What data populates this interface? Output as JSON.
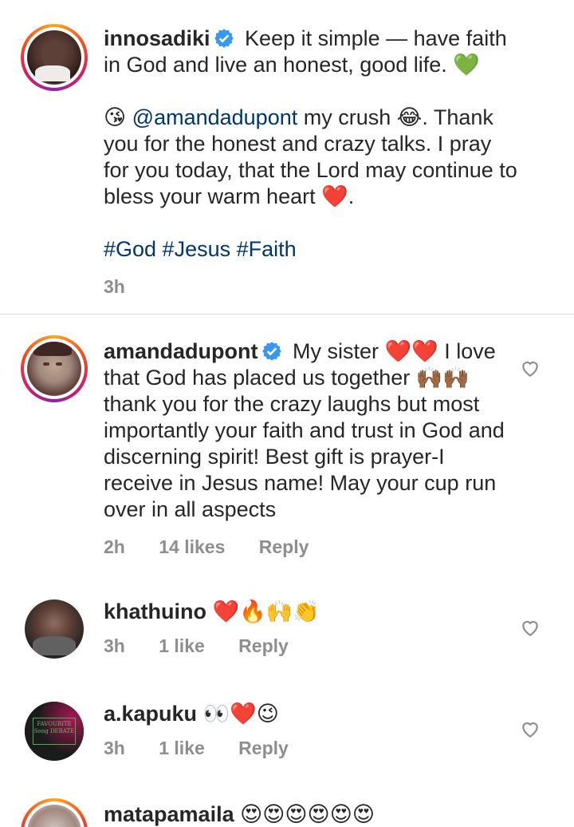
{
  "caption": {
    "username": "innosadiki",
    "text_line1": "Keep it simple — have faith in God and live an honest, good life.",
    "emoji_green_heart": "💚",
    "emoji_kiss": "😘",
    "mention": "@amandadupont",
    "text_part2a": " my crush ",
    "emoji_laugh": "😂",
    "text_part2b": ". Thank you for the honest and crazy talks. I pray for you today, that the Lord may continue to bless your warm heart ",
    "emoji_red_heart": "❤️",
    "text_part2c": ".",
    "hashtags": "#God #Jesus #Faith",
    "time": "3h"
  },
  "comments": [
    {
      "username": "amandadupont",
      "text_a": "My sister ",
      "emoji_a": "❤️❤️",
      "text_b": " I love that God has placed us together ",
      "emoji_b": "🙌🏾🙌🏾",
      "text_c": "thank you for the crazy laughs but most importantly your faith and trust in God and discerning spirit! Best gift is prayer-I receive in Jesus name! May your cup run over in all aspects",
      "time": "2h",
      "likes": "14 likes",
      "reply": "Reply"
    },
    {
      "username": "khathuino",
      "emoji": "❤️🔥🙌👏",
      "time": "3h",
      "likes": "1 like",
      "reply": "Reply"
    },
    {
      "username": "a.kapuku",
      "emoji": "👀❤️😉",
      "time": "3h",
      "likes": "1 like",
      "reply": "Reply"
    },
    {
      "username": "matapamaila",
      "emoji": "😍😍😍😍😍😍"
    }
  ],
  "avatar3_text": "FAVOURITE Song DEBATE",
  "colors": {
    "link": "#00376b",
    "meta": "#8e8e8e",
    "verified": "#3897f0",
    "heart": "#e0245e"
  }
}
